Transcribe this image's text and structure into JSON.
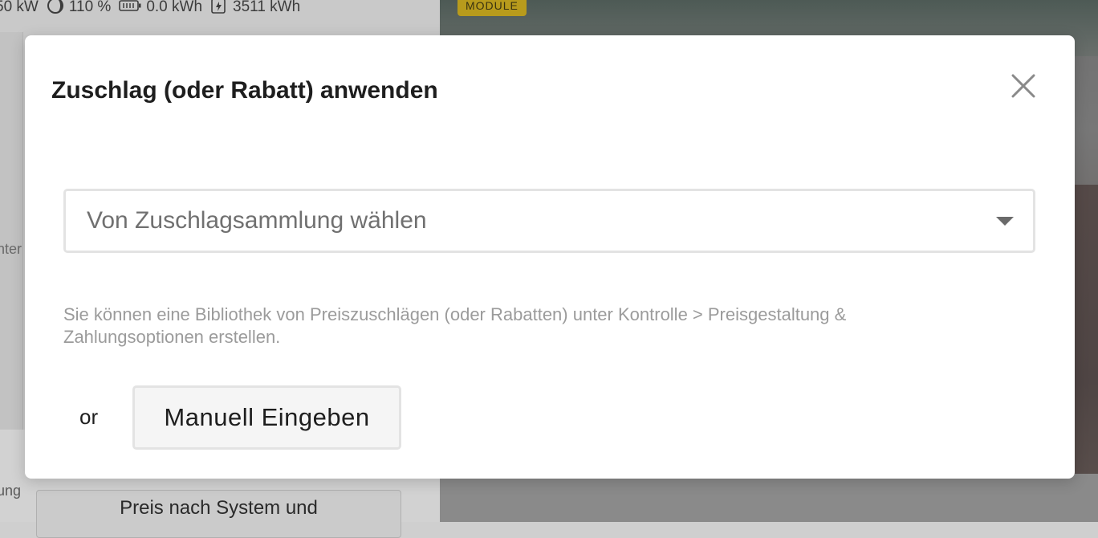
{
  "background": {
    "stats": [
      {
        "icon": "power-icon",
        "value": "50 kW"
      },
      {
        "icon": "moon-icon",
        "value": "110 %"
      },
      {
        "icon": "battery-icon",
        "value": "0.0 kWh"
      },
      {
        "icon": "lightning-icon",
        "value": "3511 kWh"
      }
    ],
    "module_badge": "MODULE",
    "side_label": "nter",
    "side_label_2": "ung",
    "price_button": "Preis nach System und"
  },
  "modal": {
    "title": "Zuschlag (oder Rabatt) anwenden",
    "close_icon": "close-icon",
    "select": {
      "placeholder": "Von Zuschlagsammlung wählen",
      "caret_icon": "caret-down-icon"
    },
    "help_text": "Sie können eine Bibliothek von Preiszuschlägen (oder Rabatten) unter Kontrolle > Preisgestaltung & Zahlungsoptionen erstellen.",
    "or_label": "or",
    "manual_button": "Manuell Eingeben"
  },
  "colors": {
    "overlay": "#cfcfcf",
    "badge": "#b89b1c",
    "title": "#1e1e1e",
    "help_text": "#9b9b9b",
    "select_text": "#707070",
    "border": "#e3e3e3"
  }
}
